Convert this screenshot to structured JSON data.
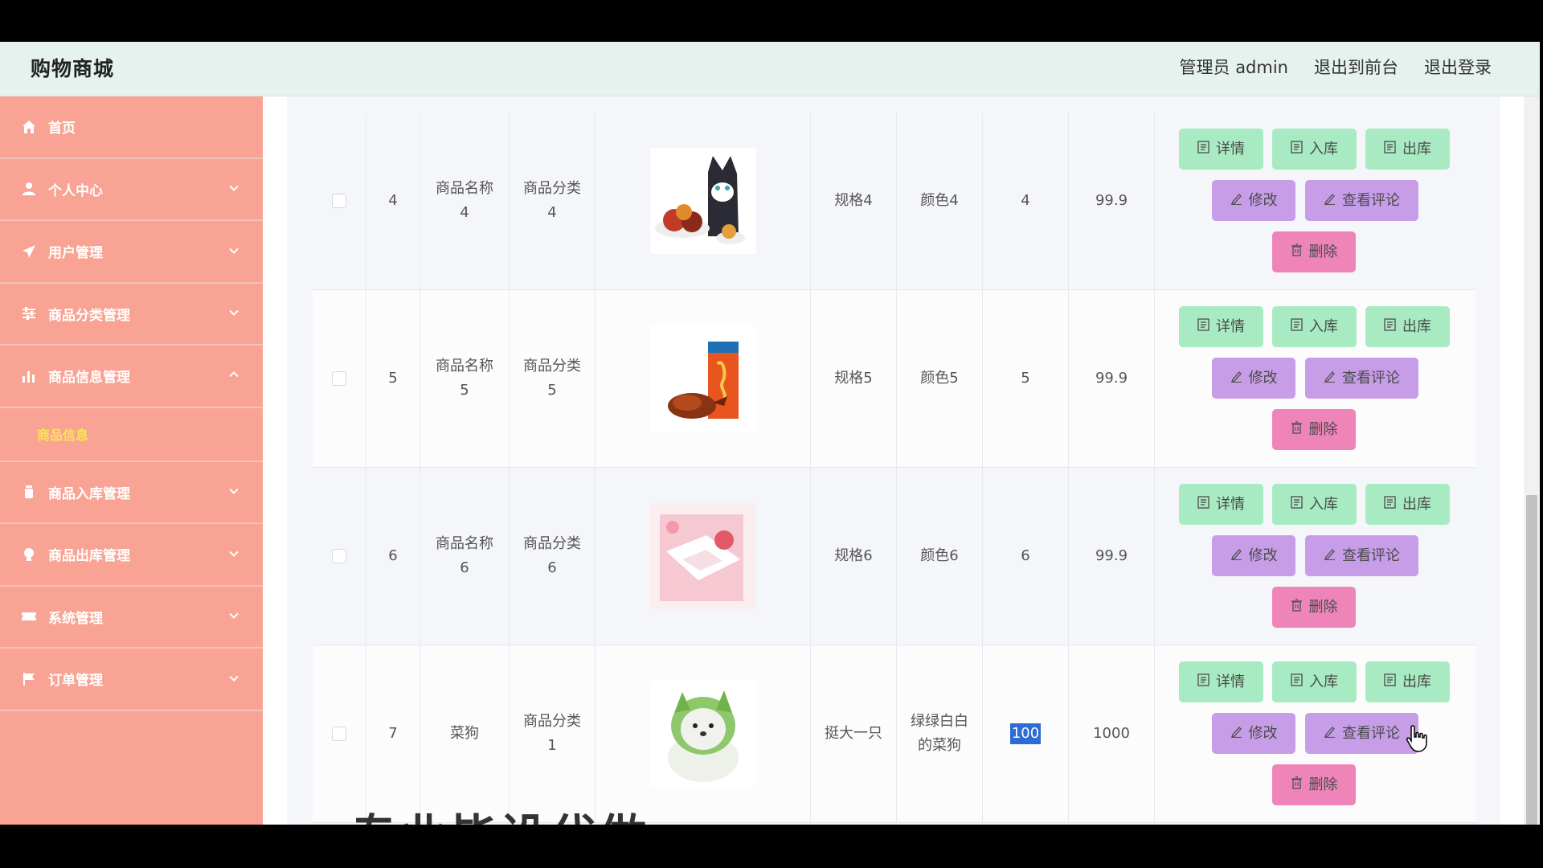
{
  "app": {
    "title": "购物商城"
  },
  "header": {
    "user_label": "管理员 admin",
    "front_label": "退出到前台",
    "logout_label": "退出登录"
  },
  "sidebar": {
    "items": [
      {
        "label": "首页",
        "icon": "home-icon"
      },
      {
        "label": "个人中心",
        "icon": "user-icon"
      },
      {
        "label": "用户管理",
        "icon": "paper-plane-icon"
      },
      {
        "label": "商品分类管理",
        "icon": "sliders-icon"
      },
      {
        "label": "商品信息管理",
        "icon": "bar-chart-icon",
        "expanded": true
      },
      {
        "label": "商品入库管理",
        "icon": "bottle-icon"
      },
      {
        "label": "商品出库管理",
        "icon": "bulb-icon"
      },
      {
        "label": "系统管理",
        "icon": "ticket-icon"
      },
      {
        "label": "订单管理",
        "icon": "flag-icon"
      }
    ],
    "submenu_active": "商品信息"
  },
  "actions": {
    "detail": "详情",
    "stock_in": "入库",
    "stock_out": "出库",
    "edit": "修改",
    "view_comments": "查看评论",
    "delete": "删除"
  },
  "table": {
    "rows": [
      {
        "index": "4",
        "name": "商品名称4",
        "category": "商品分类4",
        "spec": "规格4",
        "color": "颜色4",
        "qty": "4",
        "price": "99.9",
        "image": "snack-cat-image"
      },
      {
        "index": "5",
        "name": "商品名称5",
        "category": "商品分类5",
        "spec": "规格5",
        "color": "颜色5",
        "qty": "5",
        "price": "99.9",
        "image": "roast-duck-image"
      },
      {
        "index": "6",
        "name": "商品名称6",
        "category": "商品分类6",
        "spec": "规格6",
        "color": "颜色6",
        "qty": "6",
        "price": "99.9",
        "image": "pink-gift-image"
      },
      {
        "index": "7",
        "name": "菜狗",
        "category": "商品分类1",
        "spec": "挺大一只",
        "color": "绿绿白白的菜狗",
        "qty": "100",
        "price": "1000",
        "image": "cabbage-dog-image"
      }
    ]
  },
  "watermark": "专业毕设代做",
  "colors": {
    "header_bg": "#e6f2ee",
    "sidebar_bg": "#f8a393",
    "submenu_active": "#f7e94b",
    "btn_green": "#a8ebc2",
    "btn_purple": "#c89de8",
    "btn_pink": "#ef84b9"
  }
}
